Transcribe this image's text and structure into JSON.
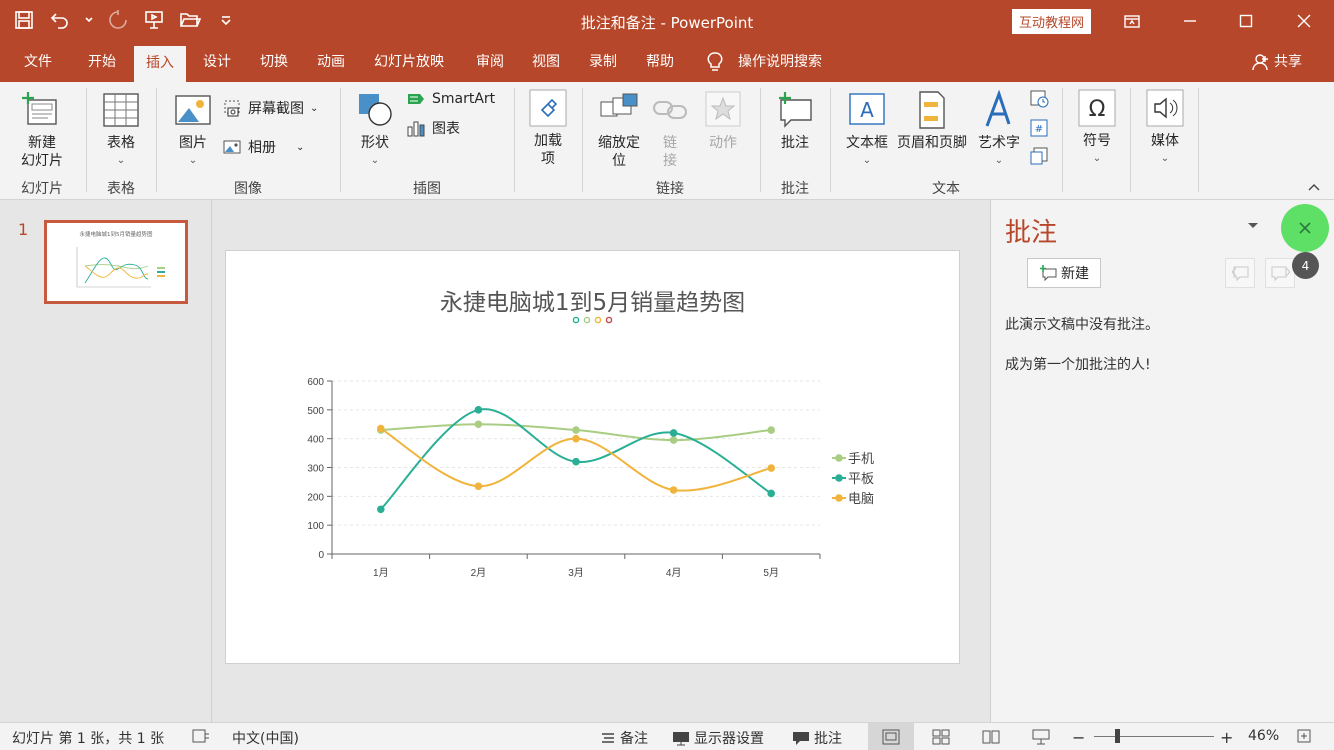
{
  "window": {
    "title": "批注和备注  -  PowerPoint",
    "brand_tag": "互动教程网",
    "accent": "#b7472a"
  },
  "tabs": [
    "文件",
    "开始",
    "插入",
    "设计",
    "切换",
    "动画",
    "幻灯片放映",
    "审阅",
    "视图",
    "录制",
    "帮助"
  ],
  "active_tab": "插入",
  "tell_me": "操作说明搜索",
  "share": "共享",
  "ribbon": {
    "new_slide": "新建\n幻灯片",
    "group_slides": "幻灯片",
    "table": "表格",
    "group_tables": "表格",
    "pictures": "图片",
    "screenshot": "屏幕截图",
    "photo_album": "相册",
    "group_images": "图像",
    "shapes": "形状",
    "smartart": "SmartArt",
    "chart": "图表",
    "group_illustrations": "插图",
    "addins": "加载\n项",
    "zoom": "缩放定\n位",
    "link": "链\n接",
    "action": "动作",
    "group_links": "链接",
    "comment": "批注",
    "group_comments": "批注",
    "textbox": "文本框",
    "header_footer": "页眉和页脚",
    "wordart": "艺术字",
    "group_text": "文本",
    "symbols": "符号",
    "media": "媒体"
  },
  "thumbnail": {
    "slide_number": "1"
  },
  "slide": {
    "chart_title": "永捷电脑城1到5月销量趋势图"
  },
  "chart_data": {
    "type": "line",
    "title": "永捷电脑城1到5月销量趋势图",
    "categories": [
      "1月",
      "2月",
      "3月",
      "4月",
      "5月"
    ],
    "ylim": [
      0,
      600
    ],
    "yticks": [
      "0",
      "100",
      "200",
      "300",
      "400",
      "500",
      "600"
    ],
    "smooth": true,
    "grid": "horizontal-dashed",
    "legend_position": "right",
    "series": [
      {
        "name": "手机",
        "color": "#a9cd82",
        "values": [
          430,
          450,
          430,
          395,
          430
        ]
      },
      {
        "name": "平板",
        "color": "#2aaf96",
        "values": [
          155,
          500,
          320,
          420,
          210
        ]
      },
      {
        "name": "电脑",
        "color": "#f0b43c",
        "values": [
          435,
          235,
          400,
          222,
          298
        ]
      }
    ],
    "title_dots": [
      "#2aaf96",
      "#a9cd82",
      "#f0b43c",
      "#c0504d"
    ]
  },
  "comments_pane": {
    "title": "批注",
    "new_button": "新建",
    "empty_message": "此演示文稿中没有批注。",
    "empty_message2": "成为第一个加批注的人!",
    "badge_count": "4"
  },
  "status": {
    "slide_info": "幻灯片 第 1 张，共 1 张",
    "language": "中文(中国)",
    "notes": "备注",
    "display_settings": "显示器设置",
    "comments": "批注",
    "zoom": "46%"
  }
}
